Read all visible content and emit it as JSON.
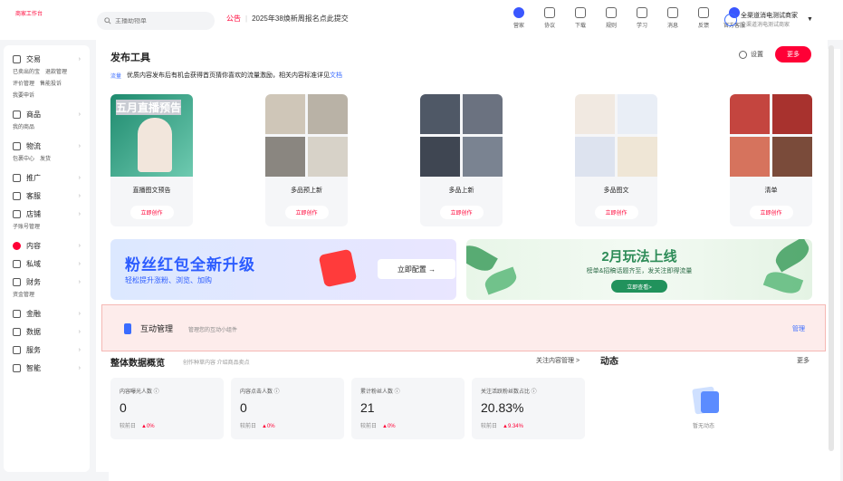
{
  "header": {
    "logo": "天猫",
    "logo_sub": "商家工作台",
    "search_placeholder": "主播助物单",
    "notice_tag": "公告",
    "notice_text": "2025年38焕新周报名点此提交",
    "tools": [
      {
        "label": "营家",
        "icon": "compass-icon"
      },
      {
        "label": "协议",
        "icon": "database-icon"
      },
      {
        "label": "下载",
        "icon": "download-icon"
      },
      {
        "label": "规则",
        "icon": "rules-icon"
      },
      {
        "label": "学习",
        "icon": "study-icon"
      },
      {
        "label": "消息",
        "icon": "message-icon"
      },
      {
        "label": "反馈",
        "icon": "feedback-icon"
      },
      {
        "label": "官方客服",
        "icon": "service-icon"
      }
    ],
    "account_name": "全渠道消电测试商家",
    "account_sub": "全渠道消电测试商家"
  },
  "sidebar": [
    {
      "label": "交易",
      "icon": "trade-icon",
      "subs": [
        "已卖出的宝",
        "退款管理",
        "评价管理",
        "售能投诉",
        "我要申诉"
      ]
    },
    {
      "label": "商品",
      "icon": "goods-icon",
      "subs": [
        "我的商品"
      ]
    },
    {
      "label": "物流",
      "icon": "logistics-icon",
      "subs": [
        "包裹中心",
        "发货"
      ]
    },
    {
      "label": "推广",
      "icon": "promote-icon",
      "subs": []
    },
    {
      "label": "客服",
      "icon": "service-icon",
      "subs": []
    },
    {
      "label": "店铺",
      "icon": "shop-icon",
      "subs": [
        "子账号管理"
      ]
    },
    {
      "label": "内容",
      "icon": "content-icon",
      "subs": [],
      "active": true
    },
    {
      "label": "私域",
      "icon": "private-icon",
      "subs": []
    },
    {
      "label": "财务",
      "icon": "finance-icon",
      "subs": [
        "资金管理"
      ]
    },
    {
      "label": "金融",
      "icon": "loan-icon",
      "subs": []
    },
    {
      "label": "数据",
      "icon": "data-icon",
      "subs": []
    },
    {
      "label": "服务",
      "icon": "apps-icon",
      "subs": []
    },
    {
      "label": "智能",
      "icon": "ai-icon",
      "subs": []
    }
  ],
  "publish": {
    "title": "发布工具",
    "settings": "设置",
    "more": "更多",
    "tip_badge": "流量",
    "tip_text": "优质内容发布后有机会获得首页猜你喜欢的流量激励，相关内容标准详见",
    "tip_link": "文档",
    "cards": [
      {
        "title": "直播图文预告",
        "button": "立即创作",
        "image": "live",
        "overlay": "五月直播预告"
      },
      {
        "title": "多品预上新",
        "button": "立即创作",
        "image": "q"
      },
      {
        "title": "多品上新",
        "button": "立即创作",
        "image": "m"
      },
      {
        "title": "多品图文",
        "button": "立即创作",
        "image": "c"
      },
      {
        "title": "清单",
        "button": "立即创作",
        "image": "r"
      }
    ]
  },
  "banners": {
    "left": {
      "title": "粉丝红包全新升级",
      "sub": "轻松提升涨粉、浏览、加购",
      "button": "立即配置 →"
    },
    "right": {
      "title": "2月玩法上线",
      "sub": "榜单&招稿话题齐至，发关注即得流量",
      "button": "立即查看>"
    }
  },
  "interaction": {
    "title": "互动管理",
    "sub": "管理您的互动小组件",
    "manage": "管理"
  },
  "overview": {
    "title": "整体数据概览",
    "sub": "创作种草内容 介绍商品卖点",
    "link": "关注内容管理 >",
    "stats": [
      {
        "label": "内容曝光人数 ⓘ",
        "value": "0",
        "compare": "较前日",
        "delta": "▲0%"
      },
      {
        "label": "内容点击人数 ⓘ",
        "value": "0",
        "compare": "较前日",
        "delta": "▲0%"
      },
      {
        "label": "累计粉丝人数 ⓘ",
        "value": "21",
        "compare": "较前日",
        "delta": "▲0%"
      },
      {
        "label": "关注活跃粉丝数占比 ⓘ",
        "value": "20.83%",
        "compare": "较前日",
        "delta": "▲9.34%"
      }
    ]
  },
  "activity": {
    "title": "动态",
    "more": "更多",
    "empty": "暂无动态"
  }
}
